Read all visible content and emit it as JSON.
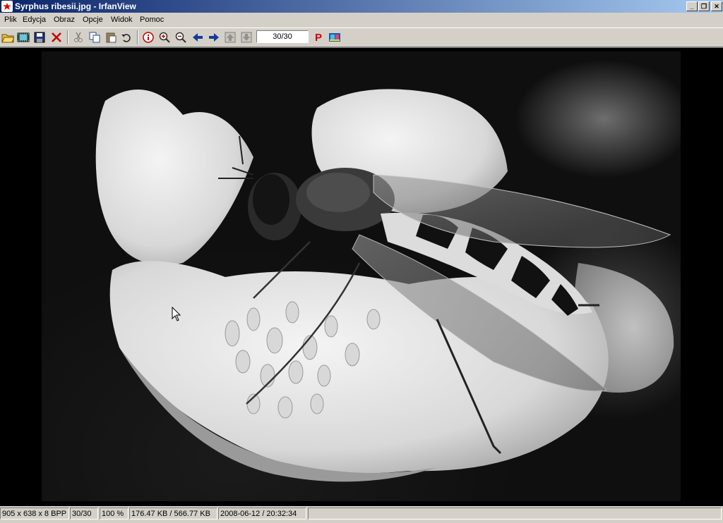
{
  "window": {
    "title": "Syrphus ribesii.jpg - IrfanView",
    "minimize": "_",
    "restore": "❐",
    "close": "✕"
  },
  "menu": [
    "Plik",
    "Edycja",
    "Obraz",
    "Opcje",
    "Widok",
    "Pomoc"
  ],
  "toolbar": {
    "page_value": "30/30",
    "plugin_label": "P"
  },
  "status": {
    "dimensions": "905 x 638 x 8 BPP",
    "index": "30/30",
    "zoom": "100 %",
    "size": "176.47 KB / 566.77 KB",
    "datetime": "2008-06-12 / 20:32:34"
  },
  "colors": {
    "titlebar_start": "#0a246a",
    "titlebar_end": "#a6caf0",
    "chrome": "#d4d0c8",
    "viewer_bg": "#000000"
  }
}
